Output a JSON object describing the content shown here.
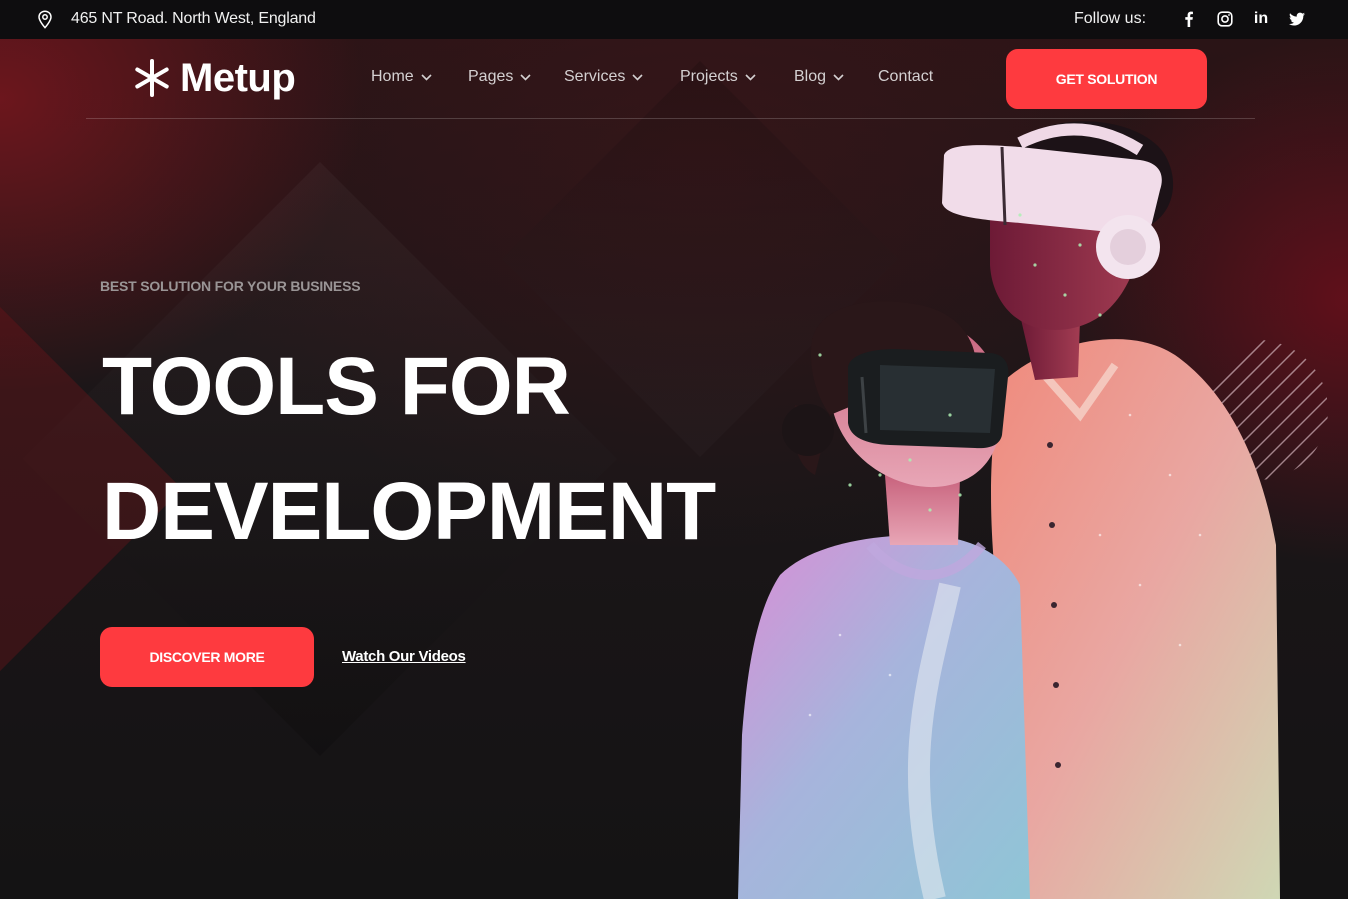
{
  "topbar": {
    "address": "465 NT Road. North West, England",
    "follow_label": "Follow us:",
    "social": [
      "facebook-icon",
      "instagram-icon",
      "linkedin-icon",
      "twitter-icon"
    ],
    "linkedin_text": "in"
  },
  "brand": {
    "name": "Metup",
    "logo_icon": "asterisk-logo-icon"
  },
  "nav": {
    "items": [
      {
        "label": "Home",
        "dropdown": true
      },
      {
        "label": "Pages",
        "dropdown": true
      },
      {
        "label": "Services",
        "dropdown": true
      },
      {
        "label": "Projects",
        "dropdown": true
      },
      {
        "label": "Blog",
        "dropdown": true
      },
      {
        "label": "Contact",
        "dropdown": false
      }
    ],
    "cta_label": "GET SOLUTION"
  },
  "hero": {
    "eyebrow": "BEST SOLUTION FOR YOUR BUSINESS",
    "title_line1": "TOOLS FOR",
    "title_line2": "DEVELOPMENT",
    "primary_button": "DISCOVER MORE",
    "secondary_link": "Watch Our Videos",
    "image": "two people wearing VR headsets"
  },
  "colors": {
    "accent": "#fe3a3f",
    "topbar_bg": "#0e0d0f",
    "hero_bg": "#161416",
    "nav_text": "#d4d0d1",
    "eyebrow_text": "#9a9596"
  }
}
